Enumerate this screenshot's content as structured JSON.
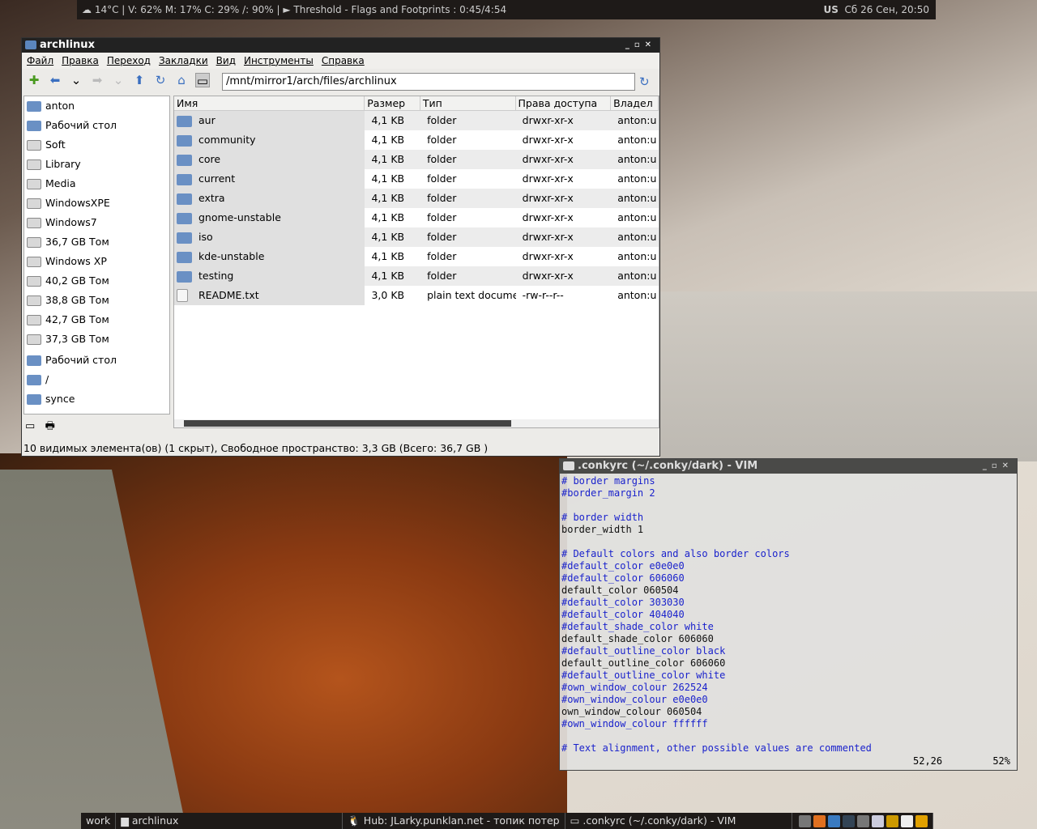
{
  "topbar": {
    "left": "☁ 14°C | V: 62% M: 17% C: 29% /: 90% | ► Threshold - Flags and Footprints : 0:45/4:54",
    "layout": "US",
    "clock": "Сб 26 Сен, 20:50"
  },
  "fm": {
    "title": "archlinux",
    "menu": [
      "Файл",
      "Правка",
      "Переход",
      "Закладки",
      "Вид",
      "Инструменты",
      "Справка"
    ],
    "address": "/mnt/mirror1/arch/files/archlinux",
    "sidebar": [
      "anton",
      "Рабочий стол",
      "Soft",
      "Library",
      "Media",
      "WindowsXPE",
      "Windows7",
      "36,7 GB Том",
      "Windows XP",
      "40,2 GB Том",
      "38,8 GB Том",
      "42,7 GB Том",
      "37,3 GB Том",
      "Рабочий стол",
      "/",
      "synce"
    ],
    "columns": [
      "Имя",
      "Размер",
      "Тип",
      "Права доступа",
      "Владел"
    ],
    "rows": [
      [
        "aur",
        "4,1 KB",
        "folder",
        "drwxr-xr-x",
        "anton:u"
      ],
      [
        "community",
        "4,1 KB",
        "folder",
        "drwxr-xr-x",
        "anton:u"
      ],
      [
        "core",
        "4,1 KB",
        "folder",
        "drwxr-xr-x",
        "anton:u"
      ],
      [
        "current",
        "4,1 KB",
        "folder",
        "drwxr-xr-x",
        "anton:u"
      ],
      [
        "extra",
        "4,1 KB",
        "folder",
        "drwxr-xr-x",
        "anton:u"
      ],
      [
        "gnome-unstable",
        "4,1 KB",
        "folder",
        "drwxr-xr-x",
        "anton:u"
      ],
      [
        "iso",
        "4,1 KB",
        "folder",
        "drwxr-xr-x",
        "anton:u"
      ],
      [
        "kde-unstable",
        "4,1 KB",
        "folder",
        "drwxr-xr-x",
        "anton:u"
      ],
      [
        "testing",
        "4,1 KB",
        "folder",
        "drwxr-xr-x",
        "anton:u"
      ],
      [
        "README.txt",
        "3,0 KB",
        "plain text documen",
        "-rw-r--r--",
        "anton:u"
      ]
    ],
    "status": "10 видимых элемента(ов) (1 скрыт), Свободное пространство: 3,3 GB (Всего: 36,7 GB )"
  },
  "vim": {
    "title": ".conkyrc (~/.conky/dark) - VIM",
    "lines": [
      "# border margins",
      "#border_margin 2",
      "",
      "# border width",
      "border_width 1",
      "",
      "# Default colors and also border colors",
      "#default_color e0e0e0",
      "#default_color 606060",
      "default_color 060504",
      "#default_color 303030",
      "#default_color 404040",
      "#default_shade_color white",
      "default_shade_color 606060",
      "#default_outline_color black",
      "default_outline_color 606060",
      "#default_outline_color white",
      "#own_window_colour 262524",
      "#own_window_colour e0e0e0",
      "own_window_colour 060504",
      "#own_window_colour ffffff",
      "",
      "# Text alignment, other possible values are commented"
    ],
    "position": "52,26",
    "percent": "52%"
  },
  "taskbar": {
    "items": [
      "work",
      "archlinux",
      "Hub: JLarky.punklan.net -  топик потер",
      ".conkyrc (~/.conky/dark) - VIM"
    ]
  }
}
